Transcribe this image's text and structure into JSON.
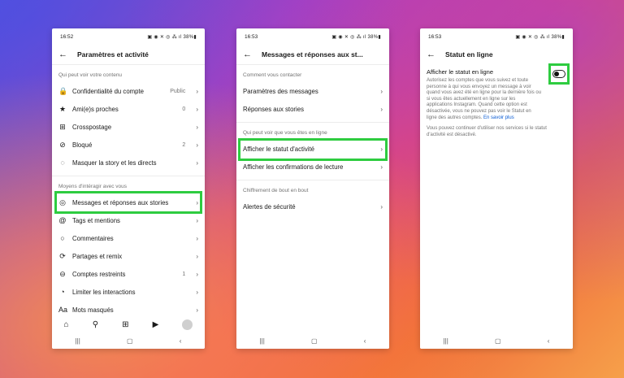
{
  "phone1": {
    "time": "16:52",
    "status_icons": "▣ ◉ ✕ ◎ ⁂ ıl 38%▮",
    "title": "Paramètres et activité",
    "section1": "Qui peut voir votre contenu",
    "items_a": [
      {
        "icon": "lock-icon",
        "glyph": "🔒",
        "label": "Confidentialité du compte",
        "value": "Public"
      },
      {
        "icon": "star-icon",
        "glyph": "★",
        "label": "Ami(e)s proches",
        "value": "0"
      },
      {
        "icon": "crosspost-icon",
        "glyph": "⊞",
        "label": "Crosspostage",
        "value": ""
      },
      {
        "icon": "block-icon",
        "glyph": "⊘",
        "label": "Bloqué",
        "value": "2"
      },
      {
        "icon": "hide-icon",
        "glyph": "◌",
        "label": "Masquer la story et les directs",
        "value": ""
      }
    ],
    "section2": "Moyens d'intéragir avec vous",
    "items_b": [
      {
        "icon": "messenger-icon",
        "glyph": "◎",
        "label": "Messages et réponses aux stories",
        "value": ""
      },
      {
        "icon": "tag-icon",
        "glyph": "@",
        "label": "Tags et mentions",
        "value": ""
      },
      {
        "icon": "comment-icon",
        "glyph": "○",
        "label": "Commentaires",
        "value": ""
      },
      {
        "icon": "remix-icon",
        "glyph": "⟳",
        "label": "Partages et remix",
        "value": ""
      },
      {
        "icon": "restricted-icon",
        "glyph": "⊖",
        "label": "Comptes restreints",
        "value": "1"
      },
      {
        "icon": "limit-icon",
        "glyph": "◔",
        "label": "Limiter les interactions",
        "value": ""
      },
      {
        "icon": "hidden-words-icon",
        "glyph": "Aa",
        "label": "Mots masqués",
        "value": ""
      }
    ]
  },
  "phone2": {
    "time": "16:53",
    "status_icons": "▣ ◉ ✕ ◎ ⁂ ıl 38%▮",
    "title": "Messages et réponses aux st...",
    "section1": "Comment vous contacter",
    "items_a": [
      {
        "label": "Paramètres des messages"
      },
      {
        "label": "Réponses aux stories"
      }
    ],
    "section2": "Qui peut voir que vous êtes en ligne",
    "items_b": [
      {
        "label": "Afficher le statut d'activité"
      },
      {
        "label": "Afficher les confirmations de lecture"
      }
    ],
    "section3": "Chiffrement de bout en bout",
    "items_c": [
      {
        "label": "Alertes de sécurité"
      }
    ]
  },
  "phone3": {
    "time": "16:53",
    "status_icons": "▣ ◉ ✕ ◎ ⁂ ıl 38%▮",
    "title": "Statut en ligne",
    "setting_title": "Afficher le statut en ligne",
    "description": "Autorisez les comptes que vous suivez et toute personne à qui vous envoyez un message à voir quand vous avez été en ligne pour la dernière fois ou si vous êtes actuellement en ligne sur les applications Instagram. Quand cette option est désactivée, vous ne pouvez pas voir le Statut en ligne des autres comptes.",
    "learn_more": "En savoir plus",
    "note": "Vous pouvez continuer d'utiliser nos services si le statut d'activité est désactivé.",
    "toggle_on": false
  },
  "common": {
    "back_glyph": "←",
    "chevron_glyph": "›",
    "nav": {
      "home": "⌂",
      "search": "⚲",
      "create": "⊞",
      "reels": "▶"
    },
    "sysnav": {
      "recent": "|||",
      "home": "▢",
      "back": "‹"
    },
    "highlight_color": "#2ecc40"
  }
}
